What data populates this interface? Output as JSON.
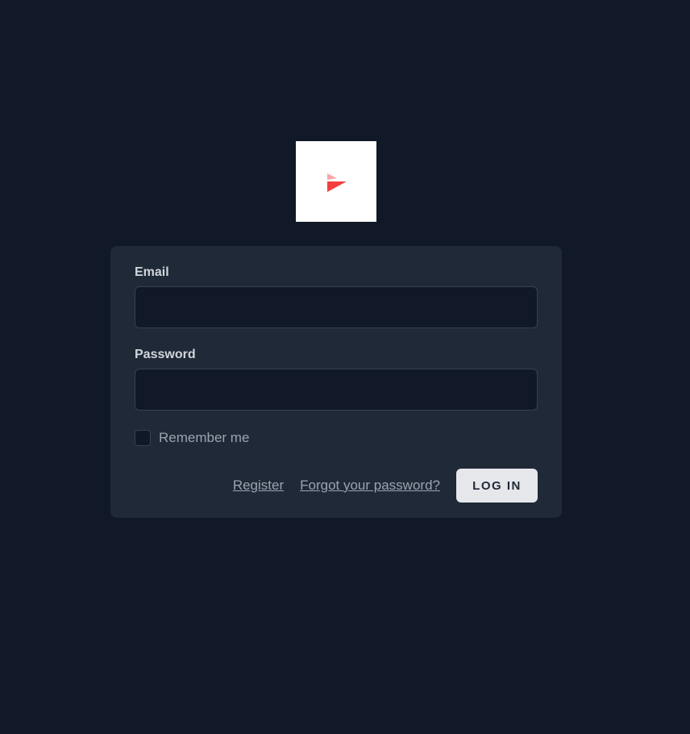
{
  "logo": {
    "icon": "red-arrow-logo-icon",
    "colors": {
      "light": "#f9a8a8",
      "dark": "#f43f3f"
    }
  },
  "form": {
    "email": {
      "label": "Email",
      "value": "",
      "placeholder": ""
    },
    "password": {
      "label": "Password",
      "value": "",
      "placeholder": ""
    },
    "remember_me": {
      "label": "Remember me",
      "checked": false
    },
    "links": {
      "register": "Register",
      "forgot_password": "Forgot your password?"
    },
    "submit_label": "LOG IN"
  },
  "colors": {
    "background": "#111827",
    "card": "#1f2937",
    "input_bg": "#111827",
    "button_bg": "#e5e7eb"
  }
}
